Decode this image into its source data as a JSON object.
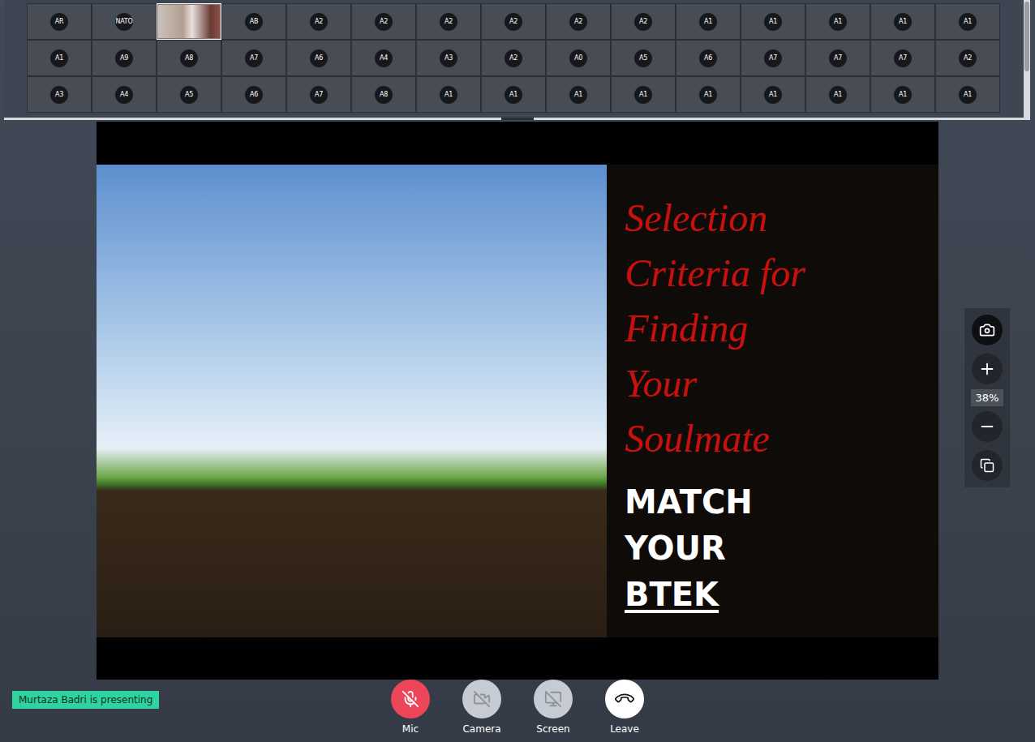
{
  "participants": [
    {
      "label": "AR",
      "kind": "avatar"
    },
    {
      "label": "NATO",
      "kind": "avatar"
    },
    {
      "label": "",
      "kind": "video"
    },
    {
      "label": "AB",
      "kind": "avatar"
    },
    {
      "label": "A2",
      "kind": "avatar"
    },
    {
      "label": "A2",
      "kind": "avatar"
    },
    {
      "label": "A2",
      "kind": "avatar"
    },
    {
      "label": "A2",
      "kind": "avatar"
    },
    {
      "label": "A2",
      "kind": "avatar"
    },
    {
      "label": "A2",
      "kind": "avatar"
    },
    {
      "label": "A1",
      "kind": "avatar"
    },
    {
      "label": "A1",
      "kind": "avatar"
    },
    {
      "label": "A1",
      "kind": "avatar"
    },
    {
      "label": "A1",
      "kind": "avatar"
    },
    {
      "label": "A1",
      "kind": "avatar"
    },
    {
      "label": "A1",
      "kind": "avatar"
    },
    {
      "label": "A9",
      "kind": "avatar"
    },
    {
      "label": "A8",
      "kind": "avatar"
    },
    {
      "label": "A7",
      "kind": "avatar"
    },
    {
      "label": "A6",
      "kind": "avatar"
    },
    {
      "label": "A4",
      "kind": "avatar"
    },
    {
      "label": "A3",
      "kind": "avatar"
    },
    {
      "label": "A2",
      "kind": "avatar"
    },
    {
      "label": "A0",
      "kind": "avatar"
    },
    {
      "label": "A5",
      "kind": "avatar"
    },
    {
      "label": "A6",
      "kind": "avatar"
    },
    {
      "label": "A7",
      "kind": "avatar"
    },
    {
      "label": "A7",
      "kind": "avatar"
    },
    {
      "label": "A7",
      "kind": "avatar"
    },
    {
      "label": "A2",
      "kind": "avatar"
    },
    {
      "label": "A3",
      "kind": "avatar"
    },
    {
      "label": "A4",
      "kind": "avatar"
    },
    {
      "label": "A5",
      "kind": "avatar"
    },
    {
      "label": "A6",
      "kind": "avatar"
    },
    {
      "label": "A7",
      "kind": "avatar"
    },
    {
      "label": "A8",
      "kind": "avatar"
    },
    {
      "label": "A1",
      "kind": "avatar"
    },
    {
      "label": "A1",
      "kind": "avatar"
    },
    {
      "label": "A1",
      "kind": "avatar"
    },
    {
      "label": "A1",
      "kind": "avatar"
    },
    {
      "label": "A1",
      "kind": "avatar"
    },
    {
      "label": "A1",
      "kind": "avatar"
    },
    {
      "label": "A1",
      "kind": "avatar"
    },
    {
      "label": "A1",
      "kind": "avatar"
    },
    {
      "label": "A1",
      "kind": "avatar"
    }
  ],
  "slide": {
    "title_lines": [
      "Selection",
      "Criteria for",
      "Finding",
      "Your",
      "Soulmate"
    ],
    "subtitle_lines": [
      {
        "text": "MATCH",
        "underlined": false
      },
      {
        "text": "YOUR",
        "underlined": false
      },
      {
        "text": "BTEK",
        "underlined": true
      }
    ]
  },
  "zoom": {
    "reading": "38%"
  },
  "presenter_banner": "Murtaza Badri is presenting",
  "controls": [
    {
      "label": "Mic",
      "kind": "mic",
      "on": false
    },
    {
      "label": "Camera",
      "kind": "camera",
      "on": false
    },
    {
      "label": "Screen",
      "kind": "screen",
      "on": false
    },
    {
      "label": "Leave",
      "kind": "leave",
      "on": true
    }
  ]
}
